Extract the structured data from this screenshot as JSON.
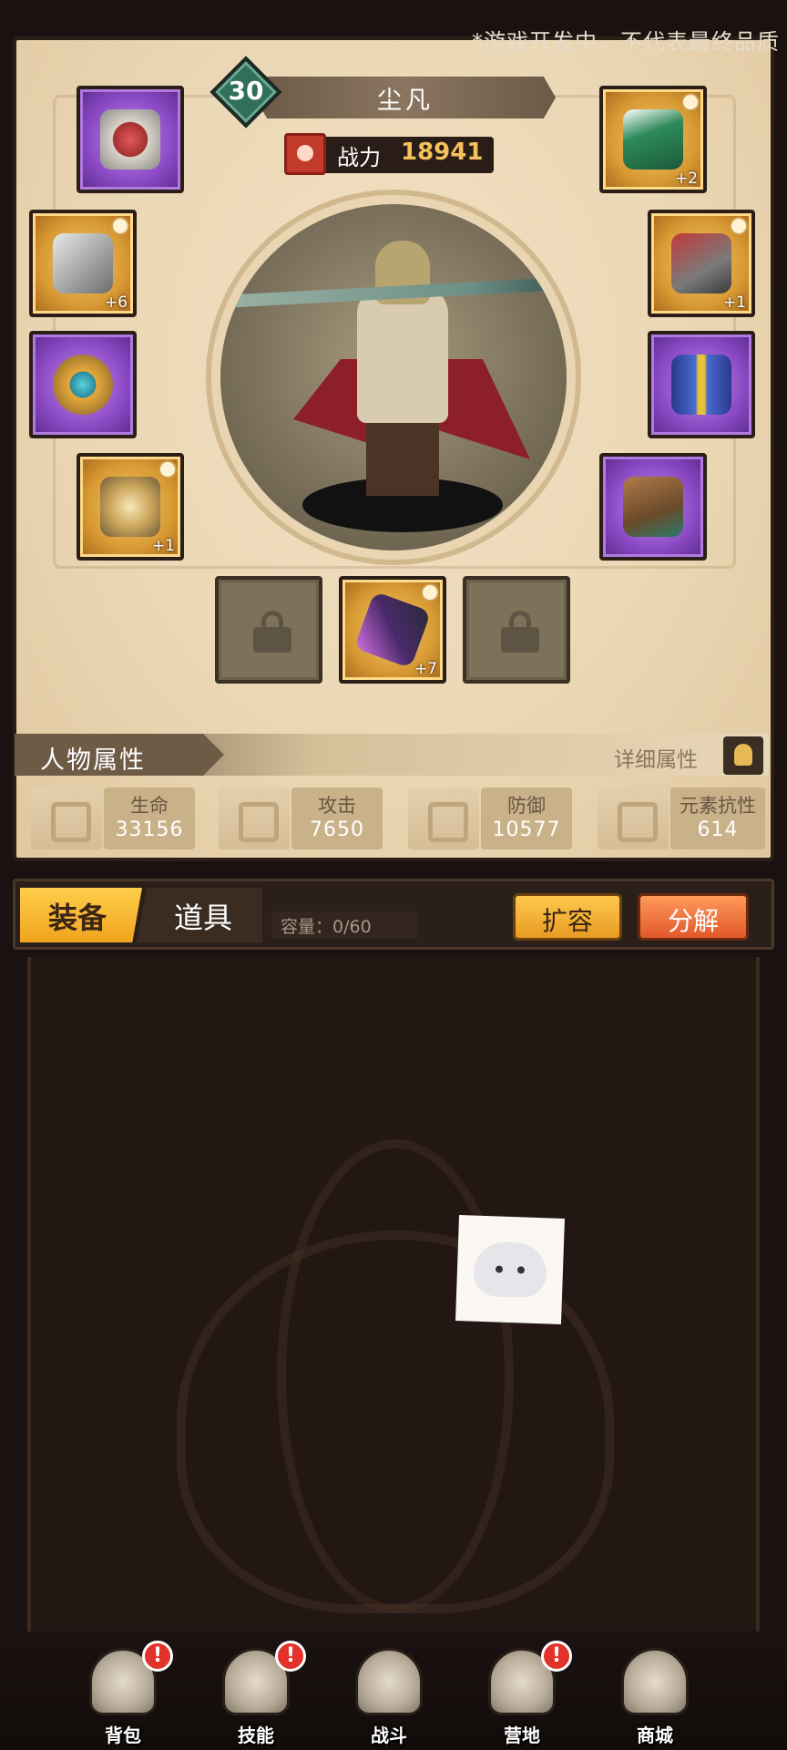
{
  "notice": "*游戏开发中，不代表最终品质",
  "hero": {
    "level": "30",
    "name": "尘凡",
    "power_label": "战力",
    "power_value": "18941"
  },
  "equipment": {
    "left": [
      {
        "name": "ring",
        "rarity": "purple",
        "plus": ""
      },
      {
        "name": "bracer",
        "rarity": "gold",
        "plus": "+6"
      },
      {
        "name": "amulet",
        "rarity": "purple",
        "plus": ""
      },
      {
        "name": "emblem",
        "rarity": "gold",
        "plus": "+1"
      }
    ],
    "right": [
      {
        "name": "hat",
        "rarity": "gold",
        "plus": "+2"
      },
      {
        "name": "armor",
        "rarity": "gold",
        "plus": "+1"
      },
      {
        "name": "belt",
        "rarity": "purple",
        "plus": ""
      },
      {
        "name": "boots",
        "rarity": "purple",
        "plus": ""
      }
    ],
    "bottom": [
      {
        "name": "locked",
        "rarity": "locked",
        "plus": ""
      },
      {
        "name": "weapon",
        "rarity": "gold",
        "plus": "+7"
      },
      {
        "name": "locked",
        "rarity": "locked",
        "plus": ""
      }
    ]
  },
  "attributes": {
    "title": "人物属性",
    "detail_label": "详细属性",
    "stats": [
      {
        "label": "生命",
        "value": "33156"
      },
      {
        "label": "攻击",
        "value": "7650"
      },
      {
        "label": "防御",
        "value": "10577"
      },
      {
        "label": "元素抗性",
        "value": "614"
      }
    ]
  },
  "tabs": {
    "equip": "装备",
    "items": "道具",
    "capacity": "容量：0/60",
    "expand": "扩容",
    "decompose": "分解"
  },
  "nav": [
    {
      "label": "背包",
      "icon": "backpack-icon",
      "badge": "!"
    },
    {
      "label": "技能",
      "icon": "skill-book-icon",
      "badge": "!"
    },
    {
      "label": "战斗",
      "icon": "battle-icon",
      "badge": ""
    },
    {
      "label": "营地",
      "icon": "castle-icon",
      "badge": "!"
    },
    {
      "label": "商城",
      "icon": "shop-icon",
      "badge": ""
    }
  ],
  "colors": {
    "parchment": "#ead6b3",
    "gold_rarity": "#d89a33",
    "purple_rarity": "#8b4ac5",
    "badge_red": "#e3312b",
    "level_green": "#2f6f5c"
  }
}
